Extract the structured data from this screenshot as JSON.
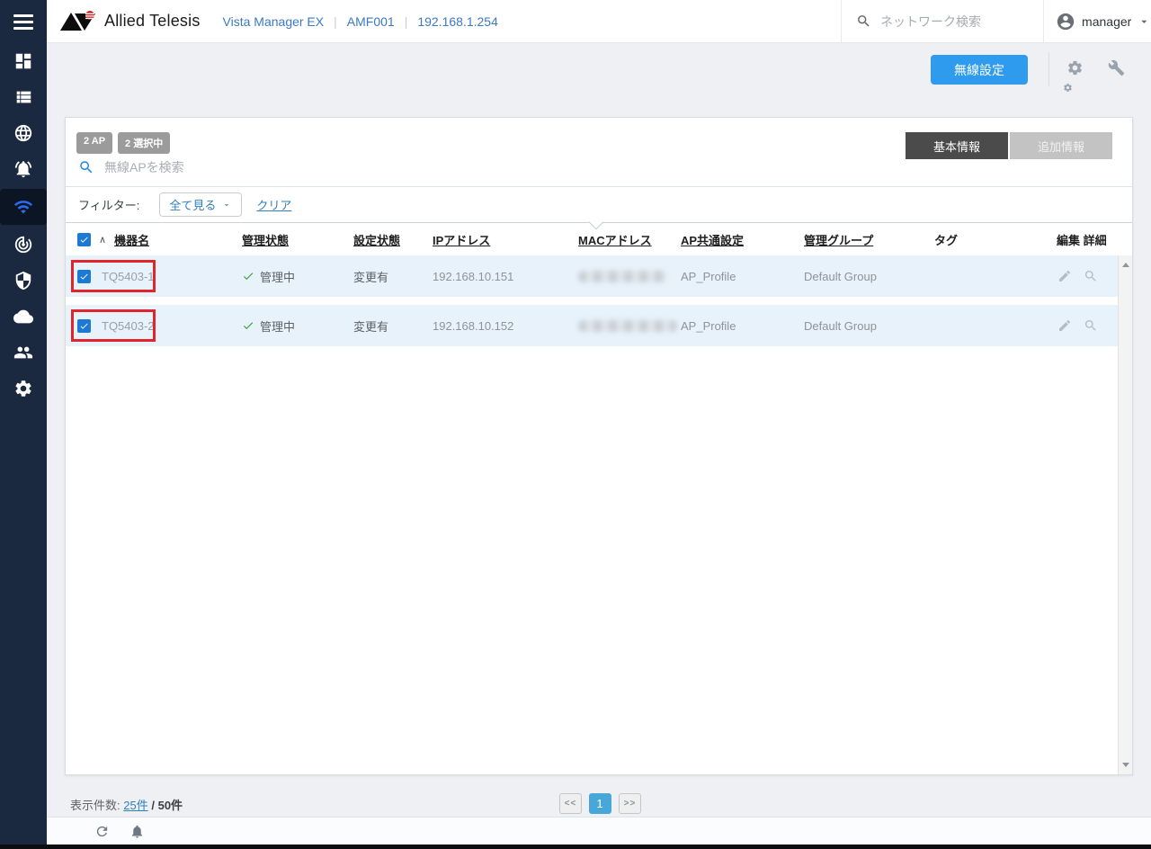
{
  "header": {
    "brand": "Allied Telesis",
    "breadcrumb": [
      "Vista Manager EX",
      "AMF001",
      "192.168.1.254"
    ],
    "search_placeholder": "ネットワーク検索",
    "user": "manager"
  },
  "sidebar": {
    "items": [
      "menu",
      "dashboard",
      "asset-list",
      "network-map",
      "event-log",
      "wireless",
      "traffic-monitoring",
      "security",
      "cloud-services",
      "user-management",
      "system-settings"
    ],
    "active_item": "wireless"
  },
  "toolbar": {
    "wireless_settings_label": "無線設定"
  },
  "panel": {
    "badges": [
      "2 AP",
      "2 選択中"
    ],
    "search_placeholder": "無線APを検索",
    "filter": {
      "label": "フィルター:",
      "dropdown_value": "全て見る",
      "clear_label": "クリア"
    },
    "tabs": [
      {
        "label": "基本情報",
        "active": true
      },
      {
        "label": "追加情報",
        "active": false
      }
    ],
    "table": {
      "sort_glyph": "∧",
      "columns": [
        {
          "label": "機器名",
          "sortable": true,
          "sorted": "asc"
        },
        {
          "label": "管理状態",
          "sortable": true
        },
        {
          "label": "設定状態",
          "sortable": true
        },
        {
          "label": "IPアドレス",
          "sortable": true
        },
        {
          "label": "MACアドレス",
          "sortable": true
        },
        {
          "label": "AP共通設定",
          "sortable": true
        },
        {
          "label": "管理グループ",
          "sortable": true
        },
        {
          "label": "タグ",
          "sortable": false
        },
        {
          "label": "編集 詳細",
          "sortable": false
        }
      ],
      "rows": [
        {
          "selected": true,
          "highlighted": true,
          "name": "TQ5403-1",
          "mgmt_status": "管理中",
          "config_status": "変更有",
          "ip": "192.168.10.151",
          "mac": "",
          "mac_redacted": true,
          "ap_profile": "AP_Profile",
          "mgmt_group": "Default Group",
          "tag": ""
        },
        {
          "selected": true,
          "highlighted": true,
          "name": "TQ5403-2",
          "mgmt_status": "管理中",
          "config_status": "変更有",
          "ip": "192.168.10.152",
          "mac": "",
          "mac_redacted": true,
          "ap_profile": "AP_Profile",
          "mgmt_group": "Default Group",
          "tag": ""
        }
      ]
    },
    "footer": {
      "count_label": "表示件数:",
      "page_size_link": "25件",
      "separator": "/",
      "total_count": "50件",
      "pagination": {
        "prev": "<<",
        "current_page": "1",
        "next": ">>"
      }
    }
  },
  "colors": {
    "sidebar_bg": "#1a2840",
    "sidebar_active_bg": "#0c1523",
    "wifi_active_blue": "#2e6bf0",
    "primary_button_blue": "#2e9bef",
    "link_blue": "#2f7fc1",
    "row_bg": "#e7f2fb",
    "tab_active_bg": "#4b4b4b",
    "tab_inactive_bg": "#c3c3c3",
    "badge_gray": "#9b9b9b",
    "annotation_red": "#e2252b",
    "status_green": "#3fa23f",
    "pagination_active": "#47a7d8"
  }
}
